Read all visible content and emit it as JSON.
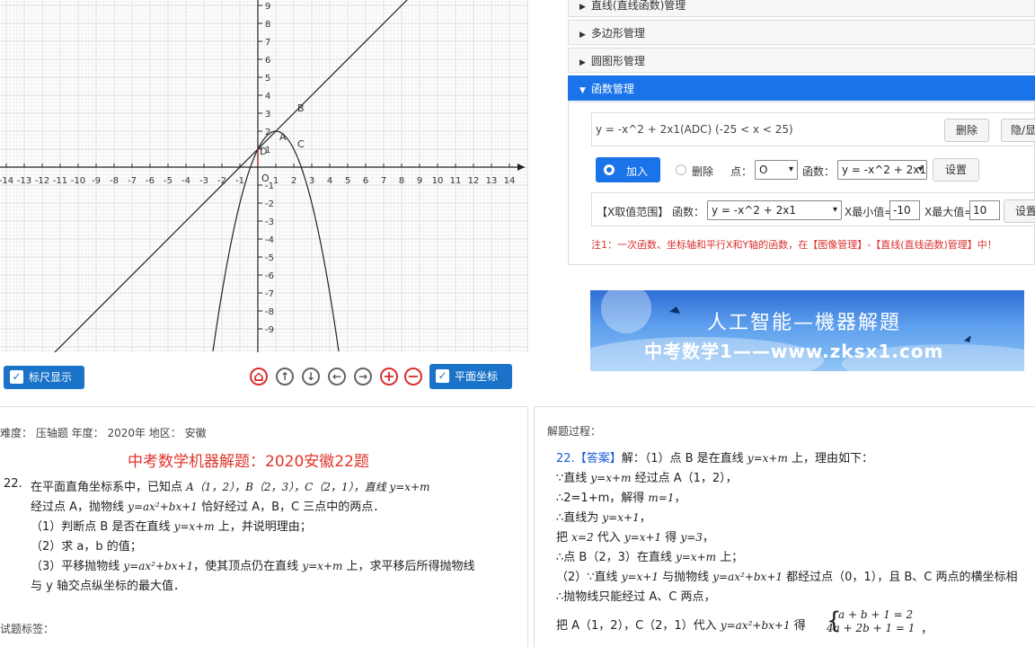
{
  "graph": {
    "x_ticks": [
      "-14",
      "-13",
      "-12",
      "-11",
      "-10",
      "-9",
      "-8",
      "-7",
      "-6",
      "-5",
      "-4",
      "-3",
      "-2",
      "-1",
      "1",
      "2",
      "3",
      "4",
      "5",
      "6",
      "7",
      "8",
      "9",
      "10",
      "11",
      "12",
      "13",
      "14"
    ],
    "y_ticks": [
      "9",
      "8",
      "7",
      "6",
      "5",
      "4",
      "3",
      "2",
      "1",
      "-1",
      "-2",
      "-3",
      "-4",
      "-5",
      "-6",
      "-7",
      "-8",
      "-9"
    ],
    "origin_label": "O",
    "point_labels": [
      "A",
      "B",
      "C",
      "D"
    ]
  },
  "toolbar": {
    "ruler_label": "标尺显示",
    "plane_label": "平面坐标",
    "check": "✓",
    "icons": {
      "home": "⌂",
      "up": "↑",
      "down": "↓",
      "left": "←",
      "right": "→",
      "zoom_in": "+",
      "zoom_out": "−"
    }
  },
  "manager": {
    "sections": [
      "直线(直线函数)管理",
      "多边形管理",
      "圆图形管理",
      "函数管理"
    ],
    "tri_closed": "▶",
    "tri_open": "▼",
    "function_entry": "y = -x^2 + 2x1(ADC) (-25 < x < 25)",
    "delete_label": "删除",
    "toggle_label": "隐/显",
    "add_label": "加入",
    "remove_label": "删除",
    "point_label": "点：",
    "point_value": "O",
    "func_label": "函数：",
    "func_value": "y = -x^2 + 2x1",
    "set_label": "设置",
    "range_label": "【X取值范围】 函数：",
    "range_func_value": "y = -x^2 + 2x1",
    "xmin_label": "X最小值=",
    "xmin_value": "-10",
    "xmax_label": "X最大值=",
    "xmax_value": "10",
    "range_set_label": "设置",
    "note": "注1：一次函数、坐标轴和平行X和Y轴的函数，在【图像管理】-【直线(直线函数)管理】中！",
    "caret": "▾"
  },
  "banner": {
    "title": "人工智能—機器解題",
    "subtitle": "中考数学1——www.zksx1.com"
  },
  "question": {
    "meta": "难度：  压轴题    年度：  2020年    地区：  安徽",
    "title": "中考数学机器解题：2020安徽22题",
    "num": "22.",
    "l1a": "在平面直角坐标系中，已知点 ",
    "l1b": "A（1，2），B（2，3），C（2，1），直线 ",
    "l1c": "y=x+m",
    "l2a": "经过点 A，抛物线 ",
    "l2b": "y=ax²+bx+1",
    "l2c": " 恰好经过 A，B，C 三点中的两点．",
    "l3a": "（1）判断点 B 是否在直线 ",
    "l3b": "y=x+m",
    "l3c": " 上，并说明理由；",
    "l4": "（2）求 a，b 的值；",
    "l5a": "（3）平移抛物线 ",
    "l5b": "y=ax²+bx+1",
    "l5c": "，使其顶点仍在直线 ",
    "l5d": "y=x+m",
    "l5e": " 上，求平移后所得抛物线",
    "l6": "与 y 轴交点纵坐标的最大值．",
    "tags": "试题标签："
  },
  "solution": {
    "header": "解题过程：",
    "num": "22.",
    "answer_tag": "【答案】",
    "s1a": "解：（1）点 B 是在直线 ",
    "s1b": "y=x+m",
    "s1c": " 上，理由如下：",
    "s2a": "∵直线 ",
    "s2b": "y=x+m",
    "s2c": " 经过点 A（1，2），",
    "s3a": "∴2=1+m，解得 ",
    "s3b": "m=1",
    "s3c": "，",
    "s4a": "∴直线为 ",
    "s4b": "y=x+1",
    "s4c": "，",
    "s5a": "把 ",
    "s5b": "x=2",
    "s5c": " 代入 ",
    "s5d": "y=x+1",
    "s5e": " 得 ",
    "s5f": "y=3",
    "s5g": "，",
    "s6a": "∴点 B（2，3）在直线 ",
    "s6b": "y=x+m",
    "s6c": " 上；",
    "s7a": "（2）∵直线 ",
    "s7b": "y=x+1",
    "s7c": " 与抛物线 ",
    "s7d": "y=ax²+bx+1",
    "s7e": " 都经过点（0，1），且 B、C 两点的横坐标相",
    "s8": "∴抛物线只能经过 A、C 两点，",
    "s9a": "把 A（1，2），C（2，1）代入 ",
    "s9b": "y=ax²+bx+1",
    "s9c": " 得",
    "eq1": "a + b + 1 = 2",
    "eq2": "4a + 2b + 1 = 1",
    "eq_end": "，"
  }
}
